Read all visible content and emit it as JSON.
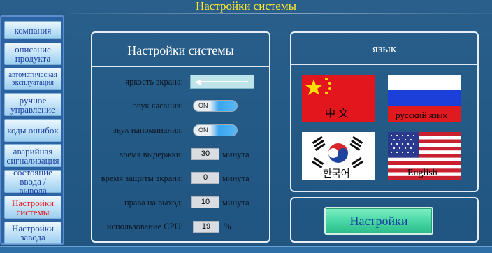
{
  "page_title": "Настройки системы",
  "sidebar": {
    "items": [
      {
        "label": "компания"
      },
      {
        "label": "описание продукта"
      },
      {
        "label": "автоматическая эксплуатация"
      },
      {
        "label": "ручное управление"
      },
      {
        "label": "коды ошибок"
      },
      {
        "label": "аварийная сигнализация"
      },
      {
        "label": "состояние ввода / вывода"
      },
      {
        "label": "Настройки системы",
        "active": true
      },
      {
        "label": "Настройки завода"
      }
    ]
  },
  "system_panel": {
    "title": "Настройки системы",
    "rows": {
      "brightness": {
        "label": "яркость экрана:",
        "level": 0
      },
      "touch_sound": {
        "label": "звук касания:",
        "value": "ON"
      },
      "reminder_sound": {
        "label": "звук напоминания:",
        "value": "ON"
      },
      "hold_time": {
        "label": "время выдержки:",
        "value": "30",
        "unit": "минута"
      },
      "screen_protect": {
        "label": "время защиты экрана:",
        "value": "0",
        "unit": "минута"
      },
      "exit_rights": {
        "label": "права на выход:",
        "value": "10",
        "unit": "минута"
      },
      "cpu_usage": {
        "label": "использование CPU:",
        "value": "19",
        "unit": "%."
      }
    }
  },
  "language_panel": {
    "title": "язык",
    "languages": [
      {
        "label": "中 文",
        "flag": "china-flag-icon"
      },
      {
        "label": "русский язык",
        "flag": "russia-flag-icon"
      },
      {
        "label": "한국어",
        "flag": "korea-flag-icon"
      },
      {
        "label": "English",
        "flag": "usa-flag-icon"
      }
    ]
  },
  "settings_button": {
    "label": "Настройки"
  },
  "colors": {
    "title_yellow": "#ffea2e",
    "nav_text": "#1b3fa0",
    "nav_active_text": "#e8131b",
    "background": "#245a86",
    "button_green": "#49d8a6"
  }
}
